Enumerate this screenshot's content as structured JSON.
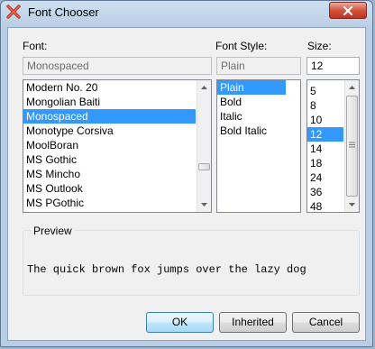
{
  "window": {
    "title": "Font Chooser",
    "close_icon": "close-icon"
  },
  "font": {
    "label": "Font:",
    "current": "Monospaced",
    "items": [
      "Modern No. 20",
      "Mongolian Baiti",
      "Monospaced",
      "Monotype Corsiva",
      "MoolBoran",
      "MS Gothic",
      "MS Mincho",
      "MS Outlook",
      "MS PGothic"
    ],
    "selected_index": 2
  },
  "style": {
    "label": "Font Style:",
    "current": "Plain",
    "items": [
      "Plain",
      "Bold",
      "Italic",
      "Bold Italic"
    ],
    "selected_index": 0
  },
  "size": {
    "label": "Size:",
    "current": "12",
    "items": [
      "5",
      "8",
      "10",
      "12",
      "14",
      "18",
      "24",
      "36",
      "48"
    ],
    "selected_index": 3
  },
  "preview": {
    "label": "Preview",
    "text": "The quick brown fox jumps over the lazy dog"
  },
  "buttons": {
    "ok": "OK",
    "inherited": "Inherited",
    "cancel": "Cancel"
  },
  "colors": {
    "selection": "#3399ff",
    "window_frame": "#b9cde4",
    "close_button": "#c2321c"
  }
}
